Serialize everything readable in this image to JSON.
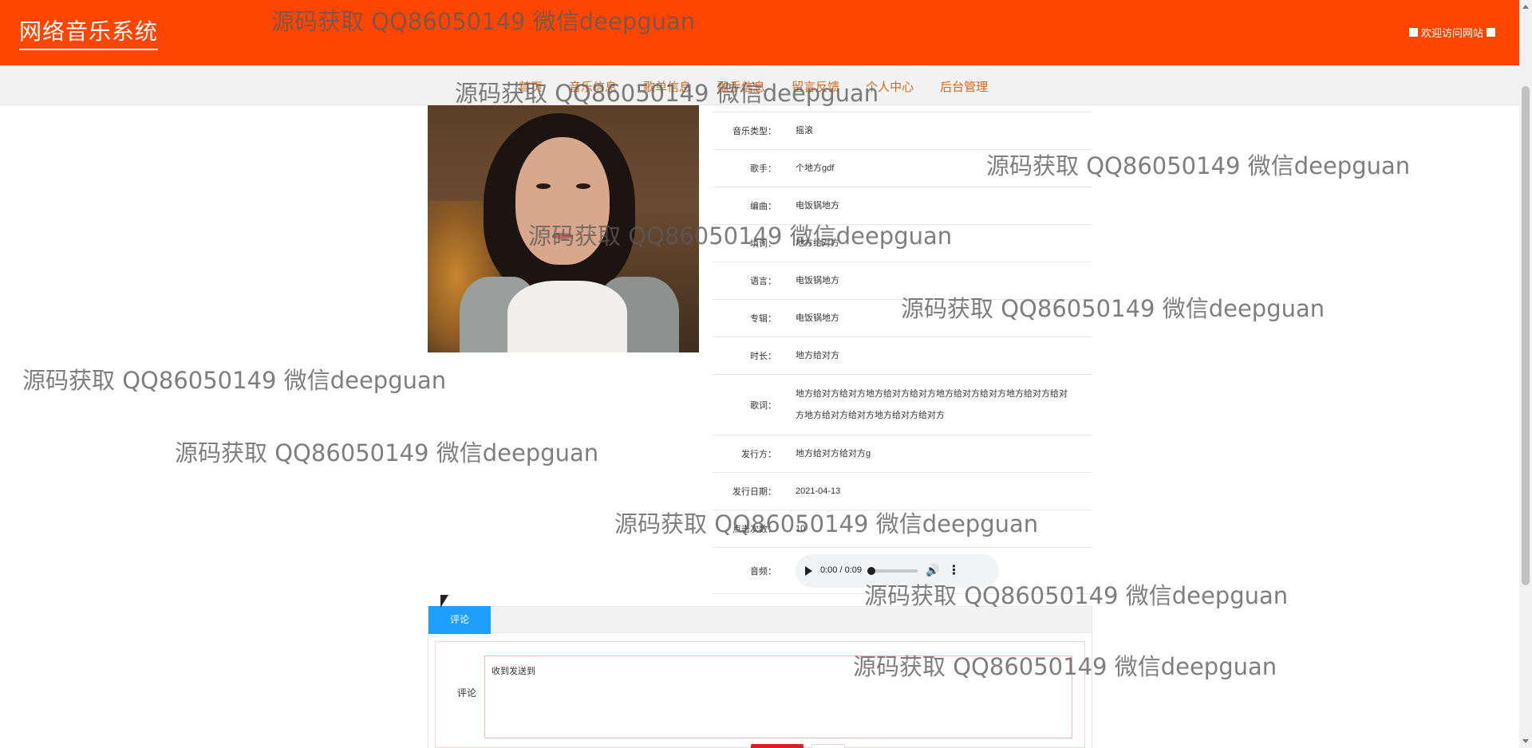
{
  "header": {
    "brand": "网络音乐系统",
    "welcome": "欢迎访问网站"
  },
  "nav": {
    "items": [
      {
        "label": "首页"
      },
      {
        "label": "音乐信息"
      },
      {
        "label": "歌单信息"
      },
      {
        "label": "歌手信息"
      },
      {
        "label": "留言反馈"
      },
      {
        "label": "个人中心"
      },
      {
        "label": "后台管理"
      }
    ]
  },
  "details": {
    "rows": [
      {
        "label": "音乐类型：",
        "value": "摇滚"
      },
      {
        "label": "歌手：",
        "value": "个地方gdf"
      },
      {
        "label": "编曲：",
        "value": "电饭锅地方"
      },
      {
        "label": "填词：",
        "value": "地方给对方"
      },
      {
        "label": "语言：",
        "value": "电饭锅地方"
      },
      {
        "label": "专辑：",
        "value": "电饭锅地方"
      },
      {
        "label": "时长：",
        "value": "地方给对方"
      },
      {
        "label": "歌词：",
        "value": "地方给对方给对方地方给对方给对方地方给对方给对方地方给对方给对方地方给对方给对方地方给对方给对方"
      },
      {
        "label": "发行方：",
        "value": "地方给对方给对方g"
      },
      {
        "label": "发行日期：",
        "value": "2021-04-13"
      },
      {
        "label": "点击次数：",
        "value": "10"
      }
    ],
    "audio_label": "音频：",
    "player": {
      "time": "0:00 / 0:09",
      "icons": [
        "play-icon",
        "volume-icon",
        "more-icon"
      ]
    }
  },
  "comment": {
    "tab": "评论",
    "label": "评论",
    "value": "收到发送到"
  },
  "watermark": "源码获取 QQ86050149 微信deepguan"
}
